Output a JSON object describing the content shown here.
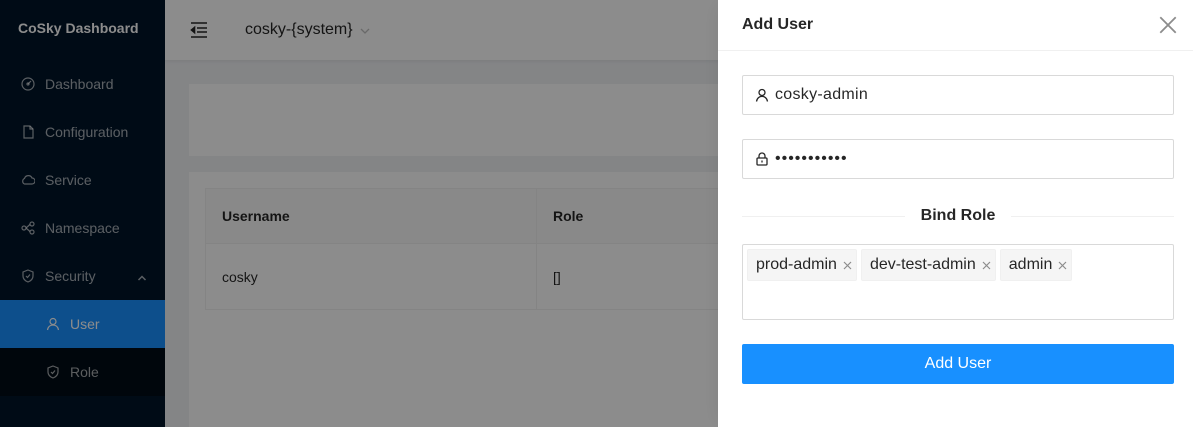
{
  "app": {
    "brand": "CoSky Dashboard"
  },
  "sidebar": {
    "items": [
      {
        "label": "Dashboard",
        "icon": "dashboard-icon"
      },
      {
        "label": "Configuration",
        "icon": "file-icon"
      },
      {
        "label": "Service",
        "icon": "cloud-icon"
      },
      {
        "label": "Namespace",
        "icon": "cluster-icon"
      },
      {
        "label": "Security",
        "icon": "safety-icon",
        "expanded": true
      }
    ],
    "security_sub": [
      {
        "label": "User",
        "icon": "user-icon",
        "active": true
      },
      {
        "label": "Role",
        "icon": "safety-icon"
      }
    ]
  },
  "header": {
    "namespace": "cosky-{system}"
  },
  "table": {
    "columns": [
      "Username",
      "Role"
    ],
    "rows": [
      {
        "username": "cosky",
        "role": "[]"
      }
    ]
  },
  "drawer": {
    "title": "Add User",
    "username_value": "cosky-admin",
    "password_value": "•••••••••••",
    "bind_role_label": "Bind Role",
    "roles": [
      "prod-admin",
      "dev-test-admin",
      "admin"
    ],
    "submit_label": "Add User"
  },
  "colors": {
    "primary": "#1890ff",
    "sider": "#001529"
  }
}
